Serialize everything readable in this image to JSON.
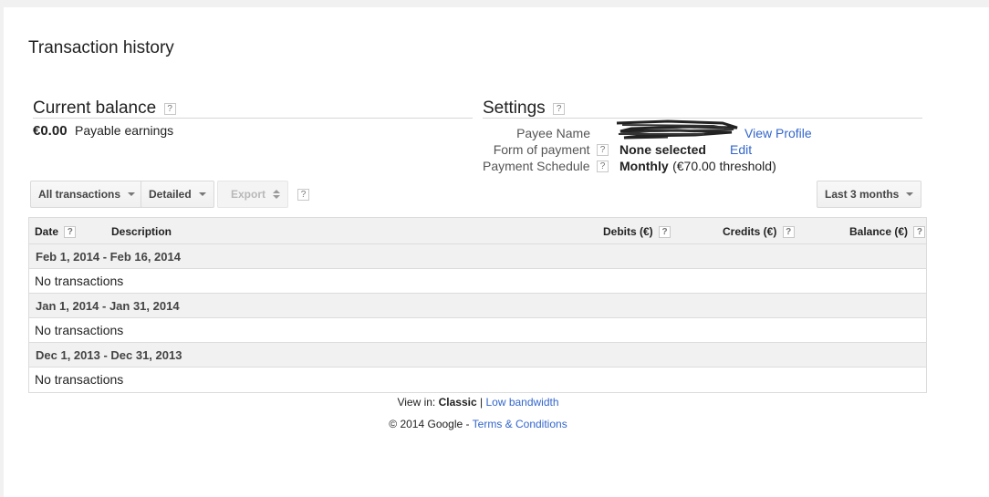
{
  "page": {
    "title": "Transaction history"
  },
  "balance": {
    "heading": "Current balance",
    "help": "?",
    "amount": "€0.00",
    "label": "Payable earnings"
  },
  "settings": {
    "heading": "Settings",
    "help": "?",
    "payee_label": "Payee Name",
    "payee_link": "View Profile",
    "payment_form_label": "Form of payment",
    "payment_form_value": "None selected",
    "payment_form_link": "Edit",
    "schedule_label": "Payment Schedule",
    "schedule_value": "Monthly",
    "schedule_detail": "(€70.00 threshold)"
  },
  "toolbar": {
    "filter_label": "All transactions",
    "view_label": "Detailed",
    "export_label": "Export",
    "help": "?",
    "range_label": "Last 3 months"
  },
  "table": {
    "columns": {
      "date": "Date",
      "description": "Description",
      "debits": "Debits (€)",
      "credits": "Credits (€)",
      "balance": "Balance (€)"
    },
    "help": "?",
    "periods": [
      {
        "range": "Feb 1, 2014 - Feb 16, 2014",
        "message": "No transactions"
      },
      {
        "range": "Jan 1, 2014 - Jan 31, 2014",
        "message": "No transactions"
      },
      {
        "range": "Dec 1, 2013 - Dec 31, 2013",
        "message": "No transactions"
      }
    ]
  },
  "footer": {
    "view_in_label": "View in:",
    "view_classic": "Classic",
    "separator": "|",
    "view_low_bandwidth": "Low bandwidth",
    "copyright": "© 2014 Google",
    "dash": "-",
    "terms_link": "Terms & Conditions"
  }
}
